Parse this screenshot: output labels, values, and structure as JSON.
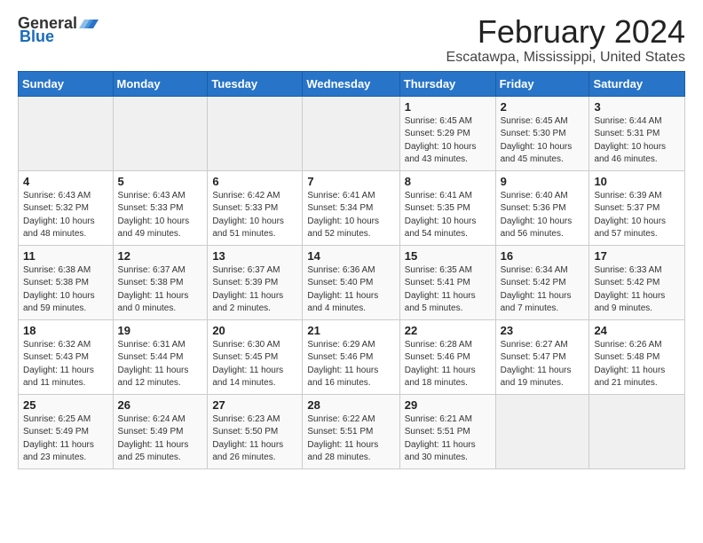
{
  "header": {
    "logo_general": "General",
    "logo_blue": "Blue",
    "main_title": "February 2024",
    "subtitle": "Escatawpa, Mississippi, United States"
  },
  "weekdays": [
    "Sunday",
    "Monday",
    "Tuesday",
    "Wednesday",
    "Thursday",
    "Friday",
    "Saturday"
  ],
  "weeks": [
    [
      {
        "day": "",
        "info": ""
      },
      {
        "day": "",
        "info": ""
      },
      {
        "day": "",
        "info": ""
      },
      {
        "day": "",
        "info": ""
      },
      {
        "day": "1",
        "info": "Sunrise: 6:45 AM\nSunset: 5:29 PM\nDaylight: 10 hours\nand 43 minutes."
      },
      {
        "day": "2",
        "info": "Sunrise: 6:45 AM\nSunset: 5:30 PM\nDaylight: 10 hours\nand 45 minutes."
      },
      {
        "day": "3",
        "info": "Sunrise: 6:44 AM\nSunset: 5:31 PM\nDaylight: 10 hours\nand 46 minutes."
      }
    ],
    [
      {
        "day": "4",
        "info": "Sunrise: 6:43 AM\nSunset: 5:32 PM\nDaylight: 10 hours\nand 48 minutes."
      },
      {
        "day": "5",
        "info": "Sunrise: 6:43 AM\nSunset: 5:33 PM\nDaylight: 10 hours\nand 49 minutes."
      },
      {
        "day": "6",
        "info": "Sunrise: 6:42 AM\nSunset: 5:33 PM\nDaylight: 10 hours\nand 51 minutes."
      },
      {
        "day": "7",
        "info": "Sunrise: 6:41 AM\nSunset: 5:34 PM\nDaylight: 10 hours\nand 52 minutes."
      },
      {
        "day": "8",
        "info": "Sunrise: 6:41 AM\nSunset: 5:35 PM\nDaylight: 10 hours\nand 54 minutes."
      },
      {
        "day": "9",
        "info": "Sunrise: 6:40 AM\nSunset: 5:36 PM\nDaylight: 10 hours\nand 56 minutes."
      },
      {
        "day": "10",
        "info": "Sunrise: 6:39 AM\nSunset: 5:37 PM\nDaylight: 10 hours\nand 57 minutes."
      }
    ],
    [
      {
        "day": "11",
        "info": "Sunrise: 6:38 AM\nSunset: 5:38 PM\nDaylight: 10 hours\nand 59 minutes."
      },
      {
        "day": "12",
        "info": "Sunrise: 6:37 AM\nSunset: 5:38 PM\nDaylight: 11 hours\nand 0 minutes."
      },
      {
        "day": "13",
        "info": "Sunrise: 6:37 AM\nSunset: 5:39 PM\nDaylight: 11 hours\nand 2 minutes."
      },
      {
        "day": "14",
        "info": "Sunrise: 6:36 AM\nSunset: 5:40 PM\nDaylight: 11 hours\nand 4 minutes."
      },
      {
        "day": "15",
        "info": "Sunrise: 6:35 AM\nSunset: 5:41 PM\nDaylight: 11 hours\nand 5 minutes."
      },
      {
        "day": "16",
        "info": "Sunrise: 6:34 AM\nSunset: 5:42 PM\nDaylight: 11 hours\nand 7 minutes."
      },
      {
        "day": "17",
        "info": "Sunrise: 6:33 AM\nSunset: 5:42 PM\nDaylight: 11 hours\nand 9 minutes."
      }
    ],
    [
      {
        "day": "18",
        "info": "Sunrise: 6:32 AM\nSunset: 5:43 PM\nDaylight: 11 hours\nand 11 minutes."
      },
      {
        "day": "19",
        "info": "Sunrise: 6:31 AM\nSunset: 5:44 PM\nDaylight: 11 hours\nand 12 minutes."
      },
      {
        "day": "20",
        "info": "Sunrise: 6:30 AM\nSunset: 5:45 PM\nDaylight: 11 hours\nand 14 minutes."
      },
      {
        "day": "21",
        "info": "Sunrise: 6:29 AM\nSunset: 5:46 PM\nDaylight: 11 hours\nand 16 minutes."
      },
      {
        "day": "22",
        "info": "Sunrise: 6:28 AM\nSunset: 5:46 PM\nDaylight: 11 hours\nand 18 minutes."
      },
      {
        "day": "23",
        "info": "Sunrise: 6:27 AM\nSunset: 5:47 PM\nDaylight: 11 hours\nand 19 minutes."
      },
      {
        "day": "24",
        "info": "Sunrise: 6:26 AM\nSunset: 5:48 PM\nDaylight: 11 hours\nand 21 minutes."
      }
    ],
    [
      {
        "day": "25",
        "info": "Sunrise: 6:25 AM\nSunset: 5:49 PM\nDaylight: 11 hours\nand 23 minutes."
      },
      {
        "day": "26",
        "info": "Sunrise: 6:24 AM\nSunset: 5:49 PM\nDaylight: 11 hours\nand 25 minutes."
      },
      {
        "day": "27",
        "info": "Sunrise: 6:23 AM\nSunset: 5:50 PM\nDaylight: 11 hours\nand 26 minutes."
      },
      {
        "day": "28",
        "info": "Sunrise: 6:22 AM\nSunset: 5:51 PM\nDaylight: 11 hours\nand 28 minutes."
      },
      {
        "day": "29",
        "info": "Sunrise: 6:21 AM\nSunset: 5:51 PM\nDaylight: 11 hours\nand 30 minutes."
      },
      {
        "day": "",
        "info": ""
      },
      {
        "day": "",
        "info": ""
      }
    ]
  ]
}
